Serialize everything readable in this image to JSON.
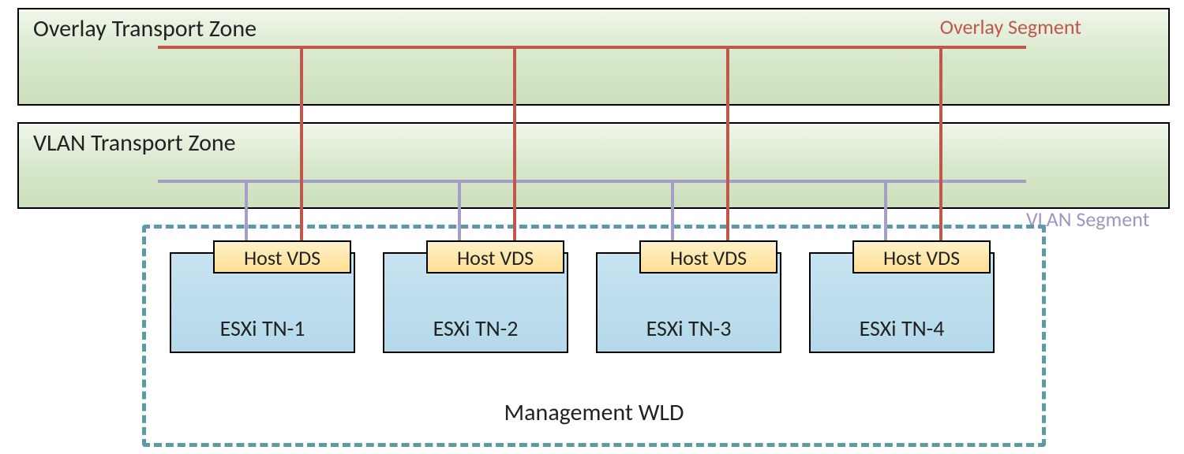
{
  "overlay_zone": {
    "title": "Overlay Transport Zone",
    "segment_label": "Overlay Segment"
  },
  "vlan_zone": {
    "title": "VLAN Transport Zone",
    "segment_label": "VLAN Segment"
  },
  "hosts": [
    {
      "vds": "Host VDS",
      "name": "ESXi TN-1"
    },
    {
      "vds": "Host VDS",
      "name": "ESXi TN-2"
    },
    {
      "vds": "Host VDS",
      "name": "ESXi TN-3"
    },
    {
      "vds": "Host VDS",
      "name": "ESXi TN-4"
    }
  ],
  "mgmt_label": "Management WLD",
  "colors": {
    "overlay_line": "#c0574b",
    "vlan_line": "#a79ec7",
    "dashed": "#5c9aa8"
  }
}
